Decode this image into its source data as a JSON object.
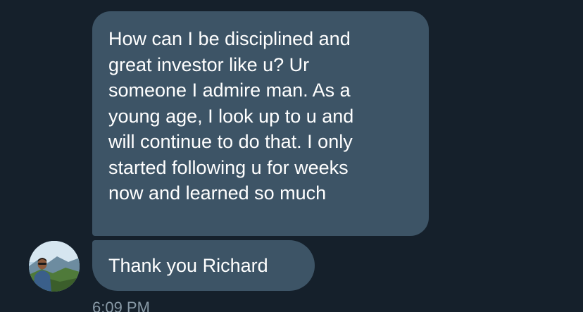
{
  "messages": [
    {
      "text": "How can I be disciplined and\ngreat investor like u? Ur\nsomeone I admire man. As a\nyoung age, I look up to u and\nwill continue to do that. I only\nstarted following u for weeks\nnow and learned so much"
    },
    {
      "text": "Thank you Richard"
    }
  ],
  "timestamp": "6:09 PM",
  "colors": {
    "background": "#15202b",
    "bubble": "#3d5466",
    "text": "#ffffff",
    "meta": "#8899a6"
  }
}
